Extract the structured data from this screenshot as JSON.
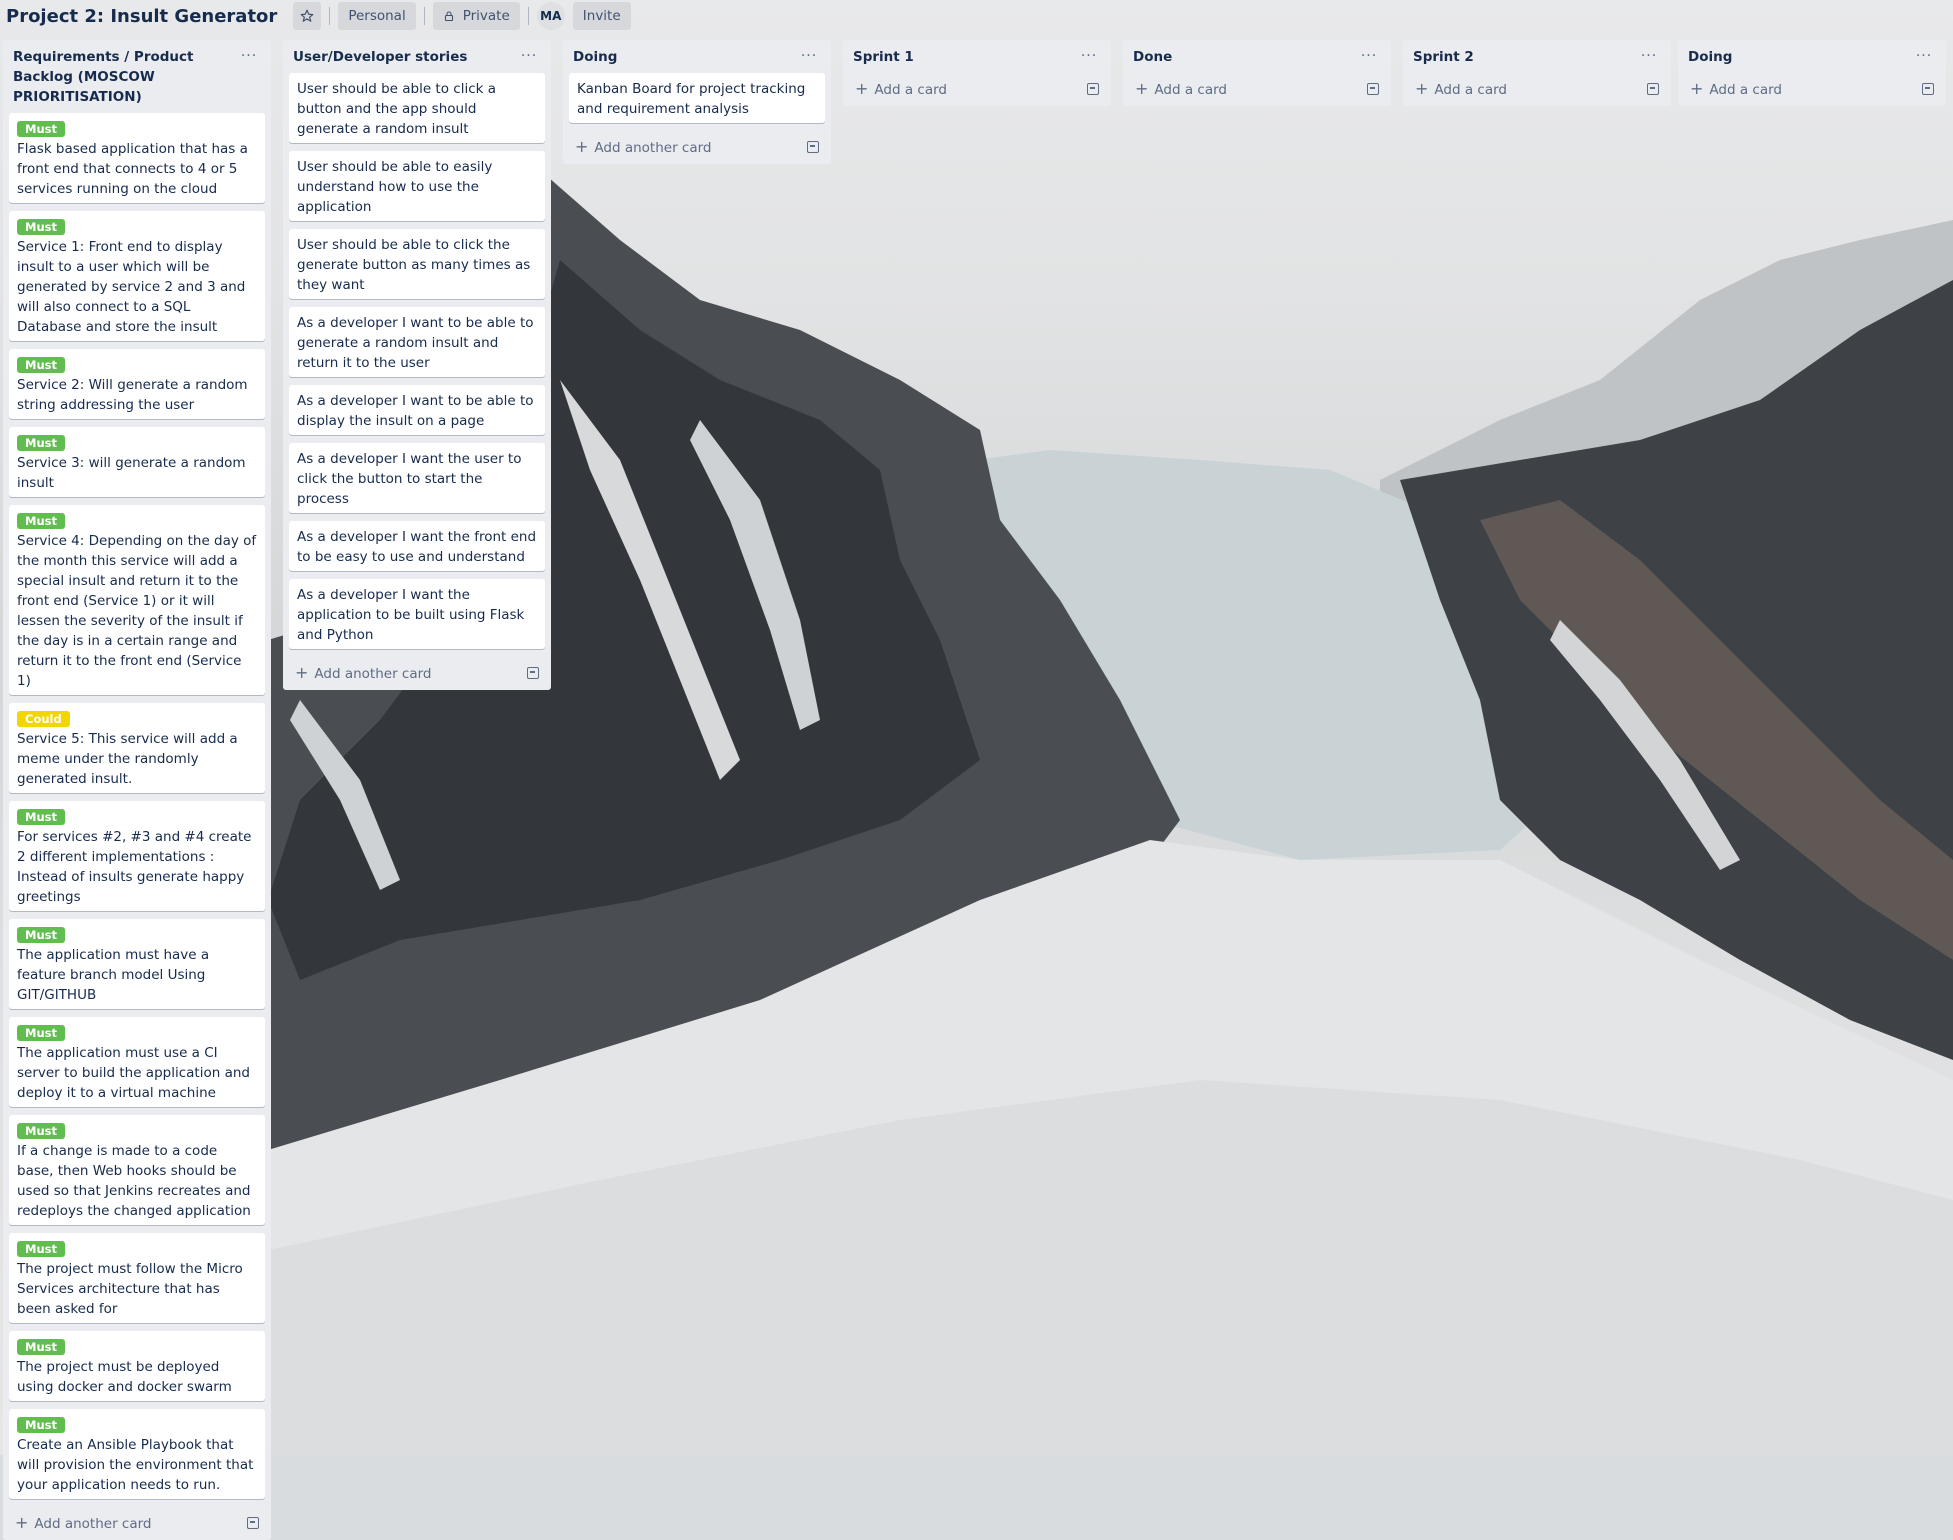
{
  "header": {
    "board_title": "Project 2: Insult Generator",
    "workspace_label": "Personal",
    "visibility_label": "Private",
    "member_initials": "MA",
    "invite_label": "Invite"
  },
  "lists": [
    {
      "title": "Requirements / Product Backlog (MOSCOW PRIORITISATION)",
      "cards": [
        {
          "label": "Must",
          "label_color": "#61bd4f",
          "text": "Flask based application that has a front end that connects to 4 or 5 services running on the cloud"
        },
        {
          "label": "Must",
          "label_color": "#61bd4f",
          "text": "Service 1: Front end to display insult to a user which will be generated by service 2 and 3 and will also connect to a SQL Database and store the insult"
        },
        {
          "label": "Must",
          "label_color": "#61bd4f",
          "text": "Service 2: Will generate a random string addressing the user"
        },
        {
          "label": "Must",
          "label_color": "#61bd4f",
          "text": "Service 3: will generate a random insult"
        },
        {
          "label": "Must",
          "label_color": "#61bd4f",
          "text": "Service 4: Depending on the day of the month this service will add a special insult and return it to the front end (Service 1) or it will lessen the severity of the insult if the day is in a certain range and return it to the front end (Service 1)"
        },
        {
          "label": "Could",
          "label_color": "#f2d600",
          "text": "Service 5: This service will add a meme under the randomly generated insult."
        },
        {
          "label": "Must",
          "label_color": "#61bd4f",
          "text": "For services #2, #3 and #4 create 2 different implementations : Instead of insults generate happy greetings"
        },
        {
          "label": "Must",
          "label_color": "#61bd4f",
          "text": "The application must have a feature branch model Using GIT/GITHUB"
        },
        {
          "label": "Must",
          "label_color": "#61bd4f",
          "text": "The application must use a CI server to build the application and deploy it to a virtual machine"
        },
        {
          "label": "Must",
          "label_color": "#61bd4f",
          "text": "If a change is made to a code base, then Web hooks should be used so that Jenkins recreates and redeploys the changed application"
        },
        {
          "label": "Must",
          "label_color": "#61bd4f",
          "text": "The project must follow the Micro Services architecture that has been asked for"
        },
        {
          "label": "Must",
          "label_color": "#61bd4f",
          "text": "The project must be deployed using docker and docker swarm"
        },
        {
          "label": "Must",
          "label_color": "#61bd4f",
          "text": "Create an Ansible Playbook that will provision the environment that your application needs to run."
        }
      ],
      "add_label": "Add another card"
    },
    {
      "title": "User/Developer stories",
      "cards": [
        {
          "text": "User should be able to click a button and the app should generate a random insult"
        },
        {
          "text": "User should be able to easily understand how to use the application"
        },
        {
          "text": "User should be able to click the generate button as many times as they want"
        },
        {
          "text": "As a developer I want to be able to generate a random insult and return it to the user"
        },
        {
          "text": "As a developer I want to be able to display the insult on a page"
        },
        {
          "text": "As a developer I want the user to click the button to start the process"
        },
        {
          "text": "As a developer I want the front end to be easy to use and understand"
        },
        {
          "text": "As a developer I want the application to be built using Flask and Python"
        }
      ],
      "add_label": "Add another card"
    },
    {
      "title": "Doing",
      "cards": [
        {
          "text": "Kanban Board for project tracking and requirement analysis"
        }
      ],
      "add_label": "Add another card"
    },
    {
      "title": "Sprint 1",
      "cards": [],
      "add_label": "Add a card"
    },
    {
      "title": "Done",
      "cards": [],
      "add_label": "Add a card"
    },
    {
      "title": "Sprint 2",
      "cards": [],
      "add_label": "Add a card"
    },
    {
      "title": "Doing",
      "cards": [],
      "add_label": "Add a card"
    }
  ],
  "icons": {
    "star": "star-icon",
    "lock": "lock-icon",
    "list_menu": "more-horizontal-icon",
    "add": "plus-icon",
    "template": "card-template-icon"
  },
  "colors": {
    "list_bg": "#ebecf0",
    "must_label": "#61bd4f",
    "could_label": "#f2d600"
  }
}
